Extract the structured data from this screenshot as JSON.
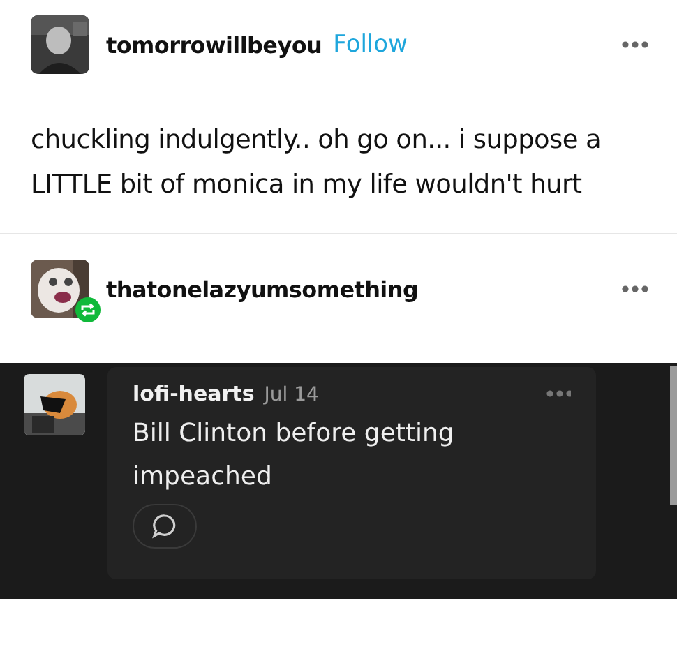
{
  "post": {
    "author": "tomorrowillbeyou",
    "follow_label": "Follow",
    "body": "chuckling indulgently..  oh go on... i suppose a LITTLE bit of monica in my life wouldn't hurt"
  },
  "reblog": {
    "author": "thatonelazyumsomething",
    "reblogged": true
  },
  "comment": {
    "author": "lofi-hearts",
    "date": "Jul 14",
    "text": "Bill Clinton before getting impeached"
  }
}
